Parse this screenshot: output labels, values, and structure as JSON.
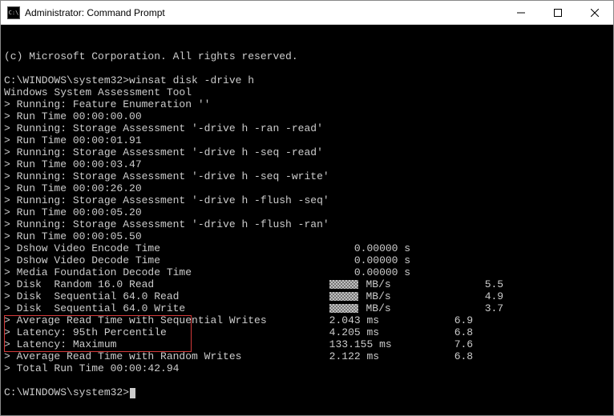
{
  "titlebar": {
    "icon_text": "C:\\",
    "title": "Administrator: Command Prompt"
  },
  "copyright": "(c) Microsoft Corporation. All rights reserved.",
  "prompt_line": "C:\\WINDOWS\\system32>winsat disk -drive h",
  "tool_name": "Windows System Assessment Tool",
  "runs": [
    {
      "label": "Running: Feature Enumeration ''",
      "time": "Run Time 00:00:00.00"
    },
    {
      "label": "Running: Storage Assessment '-drive h -ran -read'",
      "time": "Run Time 00:00:01.91"
    },
    {
      "label": "Running: Storage Assessment '-drive h -seq -read'",
      "time": "Run Time 00:00:03.47"
    },
    {
      "label": "Running: Storage Assessment '-drive h -seq -write'",
      "time": "Run Time 00:00:26.20"
    },
    {
      "label": "Running: Storage Assessment '-drive h -flush -seq'",
      "time": "Run Time 00:00:05.20"
    },
    {
      "label": "Running: Storage Assessment '-drive h -flush -ran'",
      "time": "Run Time 00:00:05.50"
    }
  ],
  "timings": [
    {
      "label": "Dshow Video Encode Time",
      "val": "0.00000 s",
      "score": ""
    },
    {
      "label": "Dshow Video Decode Time",
      "val": "0.00000 s",
      "score": ""
    },
    {
      "label": "Media Foundation Decode Time",
      "val": "0.00000 s",
      "score": ""
    }
  ],
  "disk_rows": [
    {
      "label": "Disk  Random 16.0 Read",
      "unit": "MB/s",
      "score": "5.5"
    },
    {
      "label": "Disk  Sequential 64.0 Read",
      "unit": "MB/s",
      "score": "4.9"
    },
    {
      "label": "Disk  Sequential 64.0 Write",
      "unit": "MB/s",
      "score": "3.7"
    }
  ],
  "summary": [
    {
      "label": "Average Read Time with Sequential Writes",
      "val": "2.043 ms",
      "score": "6.9"
    },
    {
      "label": "Latency: 95th Percentile",
      "val": "4.205 ms",
      "score": "6.8"
    },
    {
      "label": "Latency: Maximum",
      "val": "133.155 ms",
      "score": "7.6"
    },
    {
      "label": "Average Read Time with Random Writes",
      "val": "2.122 ms",
      "score": "6.8"
    }
  ],
  "total": "Total Run Time 00:00:42.94",
  "final_prompt": "C:\\WINDOWS\\system32>"
}
